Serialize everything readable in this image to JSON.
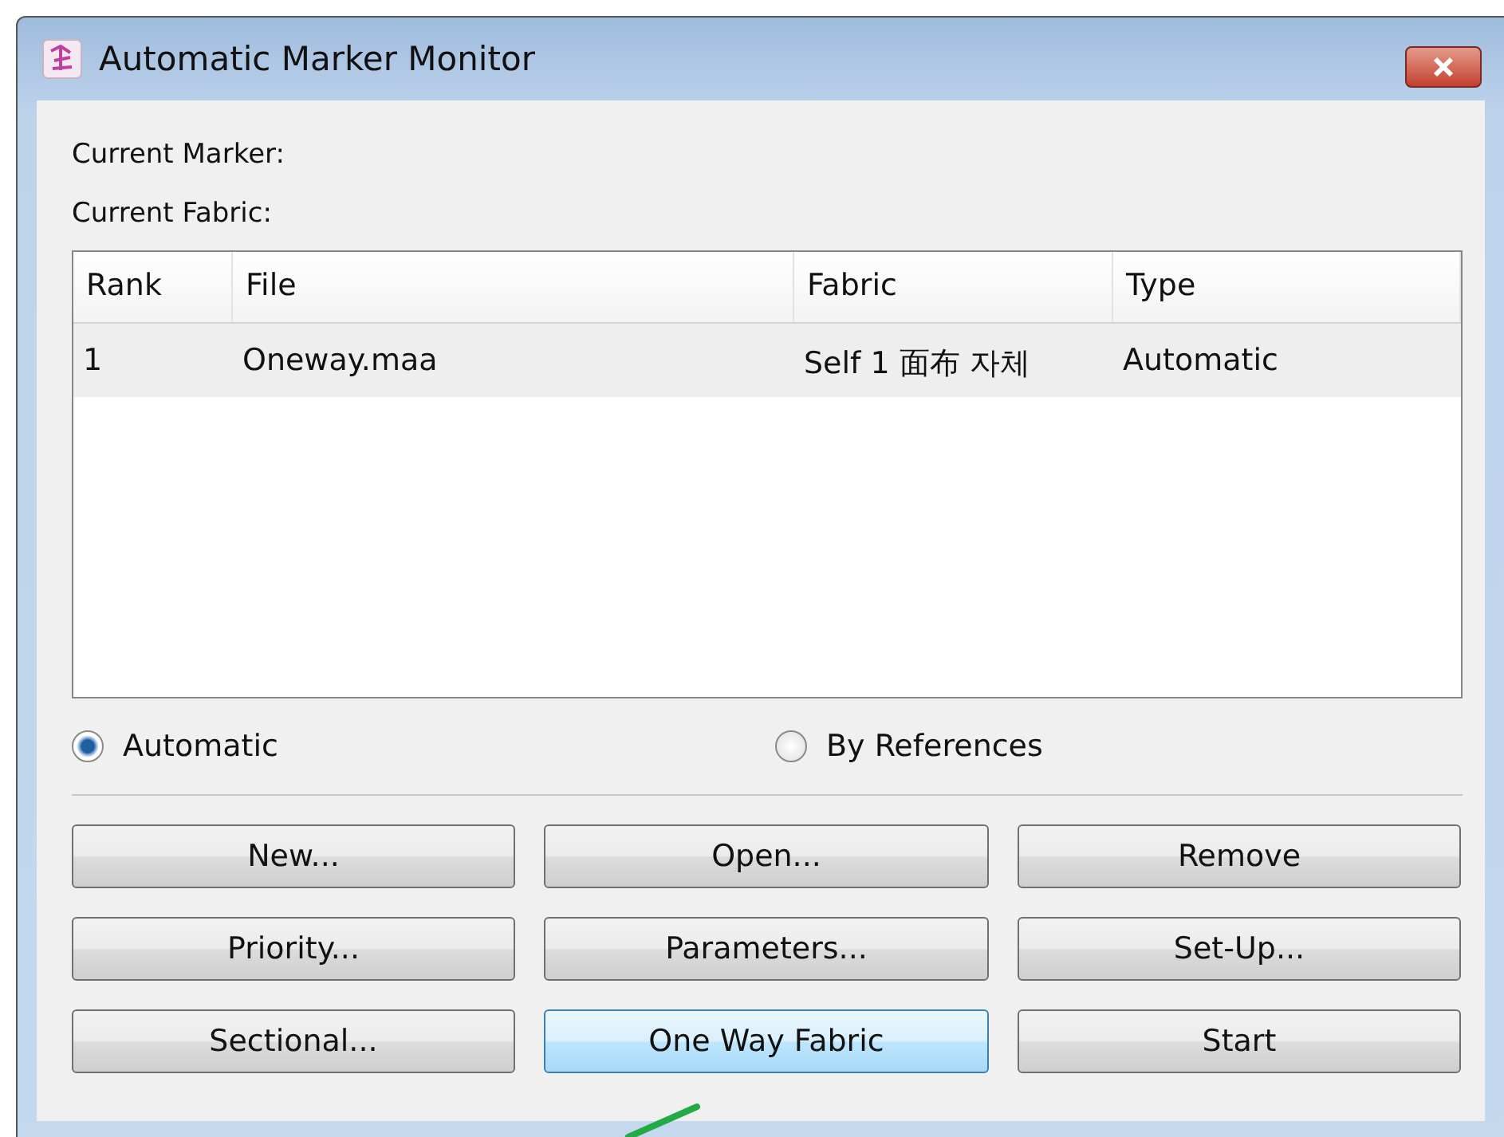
{
  "window": {
    "title": "Automatic Marker Monitor"
  },
  "info": [
    {
      "label": "Current Marker:"
    },
    {
      "label": "Current Fabric:"
    }
  ],
  "table": {
    "columns": [
      "Rank",
      "File",
      "Fabric",
      "Type"
    ],
    "rows": [
      {
        "cells": [
          "1",
          "Oneway.maa",
          "Self 1 面布 자체",
          "Automatic"
        ],
        "selected": true
      }
    ]
  },
  "mode": [
    {
      "label": "Automatic",
      "selected": true
    },
    {
      "label": "By References",
      "selected": false
    }
  ],
  "buttons": [
    {
      "label": "New...",
      "hovered": false
    },
    {
      "label": "Open...",
      "hovered": false
    },
    {
      "label": "Remove",
      "hovered": false
    },
    {
      "label": "Priority...",
      "hovered": false
    },
    {
      "label": "Parameters...",
      "hovered": false
    },
    {
      "label": "Set-Up...",
      "hovered": false
    },
    {
      "label": "Sectional...",
      "hovered": false
    },
    {
      "label": "One Way Fabric",
      "hovered": true
    },
    {
      "label": "Start",
      "hovered": false
    }
  ]
}
